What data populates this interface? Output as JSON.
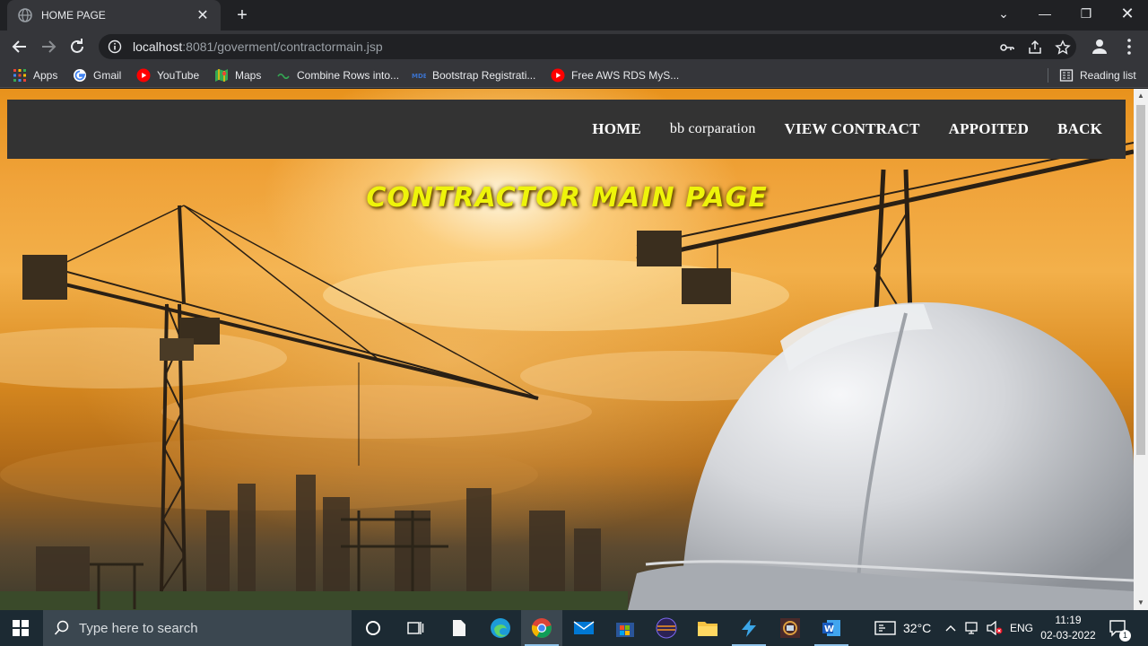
{
  "browser": {
    "tab_title": "HOME PAGE",
    "url_host": "localhost",
    "url_path": ":8081/goverment/contractormain.jsp",
    "bookmarks": [
      {
        "label": "Apps",
        "icon": "apps-grid-icon"
      },
      {
        "label": "Gmail",
        "icon": "google-icon"
      },
      {
        "label": "YouTube",
        "icon": "youtube-icon"
      },
      {
        "label": "Maps",
        "icon": "maps-icon"
      },
      {
        "label": "Combine Rows into...",
        "icon": "link-icon"
      },
      {
        "label": "Bootstrap Registrati...",
        "icon": "mdb-icon"
      },
      {
        "label": "Free AWS RDS MyS...",
        "icon": "youtube-icon"
      }
    ],
    "reading_list": "Reading list"
  },
  "page": {
    "nav": {
      "home": "HOME",
      "company": "bb corparation",
      "view_contract": "VIEW CONTRACT",
      "appointed": "APPOITED",
      "back": "BACK"
    },
    "headline": "CONTRACTOR MAIN PAGE"
  },
  "taskbar": {
    "search_placeholder": "Type here to search",
    "temperature": "32°C",
    "language": "ENG",
    "time": "11:19",
    "date": "02-03-2022",
    "notification_count": "1"
  },
  "colors": {
    "headline": "#eef40a",
    "nav_bg": "#333333",
    "sky_orange": "#f0a33a"
  }
}
